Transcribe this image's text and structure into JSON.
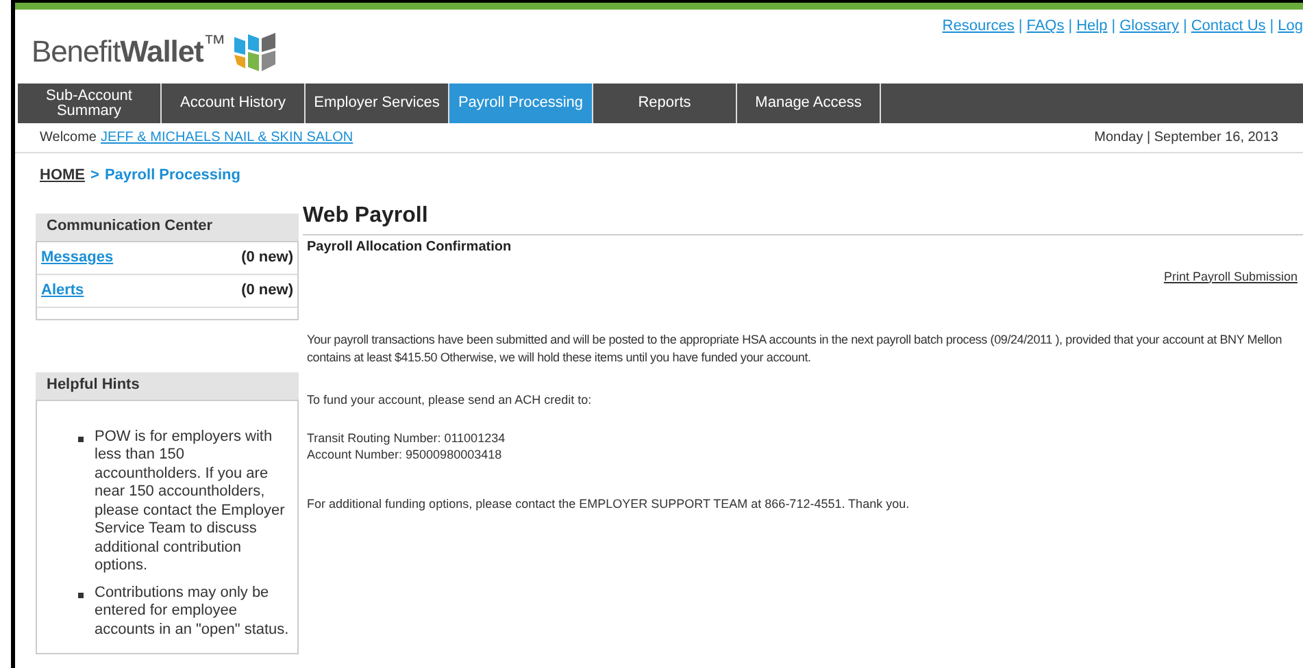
{
  "logo": {
    "text": "Benefit**Wallet**$^{™}$"
  },
  "top_links": [
    "Resources",
    "FAQs",
    "Help",
    "Glossary",
    "Contact Us",
    "Log"
  ],
  "link_separator": "|",
  "nav": [
    {
      "label": "Sub-Account Summary",
      "selected": false
    },
    {
      "label": "Account History",
      "selected": false
    },
    {
      "label": "Employer Services",
      "selected": false
    },
    {
      "label": "Payroll Processing",
      "selected": true
    },
    {
      "label": "Reports",
      "selected": false
    },
    {
      "label": "Manage Access",
      "selected": false
    }
  ],
  "welcome": {
    "label": "Welcome",
    "name": "JEFF & MICHAELS NAIL & SKIN SALON",
    "date": "Monday | September 16, 2013"
  },
  "breadcrumb": {
    "home": "HOME",
    "separator": ">",
    "current": "Payroll Processing"
  },
  "communication_center": {
    "title": "Communication Center",
    "items": [
      {
        "label": "Messages",
        "count": "(0 new)"
      },
      {
        "label": "Alerts",
        "count": "(0 new)"
      }
    ]
  },
  "helpful_hints": {
    "title": "Helpful Hints",
    "items": [
      "POW is for employers with less than 150 accountholders. If you are near 150 accountholders, please contact the Employer Service Team to discuss additional contribution options.",
      "Contributions may only be entered for employee accounts in an \"open\" status."
    ]
  },
  "main": {
    "title": "Web Payroll",
    "subtitle": "Payroll Allocation Confirmation",
    "print_link": "Print Payroll Submission",
    "paragraphs": [
      "Your payroll transactions have been submitted and will be posted to the appropriate HSA accounts in the next payroll batch process (09/24/2011 ), provided that your account at BNY Mellon contains at least $415.50 Otherwise, we will hold these items until you have funded your account.",
      "To fund your account, please send an ACH credit to:"
    ],
    "account_lines": [
      "Transit Routing Number: 011001234",
      "Account Number: 95000980003418"
    ],
    "closing": "For additional funding options, please contact the EMPLOYER SUPPORT TEAM at 866-712-4551. Thank you."
  }
}
